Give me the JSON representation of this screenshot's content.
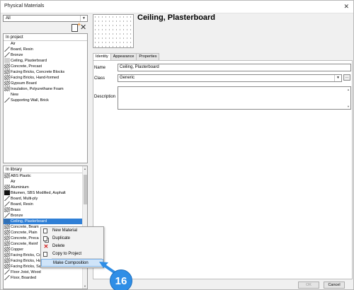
{
  "window": {
    "title": "Physical Materials"
  },
  "filter": {
    "value": "All"
  },
  "project_list": {
    "header": "In project",
    "items": [
      {
        "label": "Air",
        "swatch": "air"
      },
      {
        "label": "Board, Resin",
        "swatch": "line"
      },
      {
        "label": "Bronze",
        "swatch": "line"
      },
      {
        "label": "Ceiling, Plasterboard",
        "swatch": "dots"
      },
      {
        "label": "Concrete, Precast",
        "swatch": "hatch"
      },
      {
        "label": "Facing Bricks, Concrete Blocks",
        "swatch": "hatch"
      },
      {
        "label": "Facing Bricks, Hand-formed",
        "swatch": "hatch"
      },
      {
        "label": "Gypsum Board",
        "swatch": "hatch"
      },
      {
        "label": "Insulation, Polyurethane Foam",
        "swatch": "hatch"
      },
      {
        "label": "New",
        "swatch": "air"
      },
      {
        "label": "Supporting Wall, Brick",
        "swatch": "line"
      }
    ]
  },
  "library_list": {
    "header": "In library",
    "items": [
      {
        "label": "ABS Plastic",
        "swatch": "hatch"
      },
      {
        "label": "Air",
        "swatch": "air"
      },
      {
        "label": "Aluminium",
        "swatch": "hatch"
      },
      {
        "label": "Bitumen, SBS Modified, Asphalt",
        "swatch": "black"
      },
      {
        "label": "Board, Multi-ply",
        "swatch": "line"
      },
      {
        "label": "Board, Resin",
        "swatch": "line"
      },
      {
        "label": "Brass",
        "swatch": "hatch"
      },
      {
        "label": "Bronze",
        "swatch": "line"
      },
      {
        "label": "Ceiling, Plasterboard",
        "swatch": "dots",
        "selected": true
      },
      {
        "label": "Concrete, Beam",
        "swatch": "hatch"
      },
      {
        "label": "Concrete, Plain",
        "swatch": "hatch"
      },
      {
        "label": "Concrete, Preca",
        "swatch": "hatch"
      },
      {
        "label": "Concrete, Reinf",
        "swatch": "hatch"
      },
      {
        "label": "Copper",
        "swatch": "hatch"
      },
      {
        "label": "Facing Bricks, Co",
        "swatch": "hatch"
      },
      {
        "label": "Facing Bricks, Hand-formed",
        "swatch": "hatch"
      },
      {
        "label": "Facing Bricks, Sand-lime",
        "swatch": "hatch"
      },
      {
        "label": "Floor Joist, Wood",
        "swatch": "line"
      },
      {
        "label": "Floor, Boarded",
        "swatch": "line"
      }
    ]
  },
  "material": {
    "name": "Ceiling, Plasterboard"
  },
  "tabs": [
    "Identity",
    "Appearance",
    "Properties"
  ],
  "identity": {
    "name_label": "Name",
    "name_value": "Ceiling, Plasterboard",
    "class_label": "Class",
    "class_value": "Generic",
    "description_label": "Description",
    "more_button": "..."
  },
  "context_menu": {
    "items": [
      {
        "label": "New Material",
        "icon": "new-material-icon"
      },
      {
        "label": "Duplicate",
        "icon": "duplicate-icon"
      },
      {
        "label": "Delete",
        "icon": "delete-icon"
      },
      {
        "label": "Copy to Project",
        "icon": "copy-icon"
      },
      {
        "label": "Make Composition",
        "icon": "",
        "highlighted": true
      }
    ]
  },
  "footer": {
    "ok_label": "OK",
    "cancel_label": "Cancel"
  },
  "callout": {
    "number": "16",
    "color": "#2f8ee6"
  },
  "colors": {
    "selection": "#2f7fd6",
    "menu_highlight": "#cfe4f9"
  }
}
